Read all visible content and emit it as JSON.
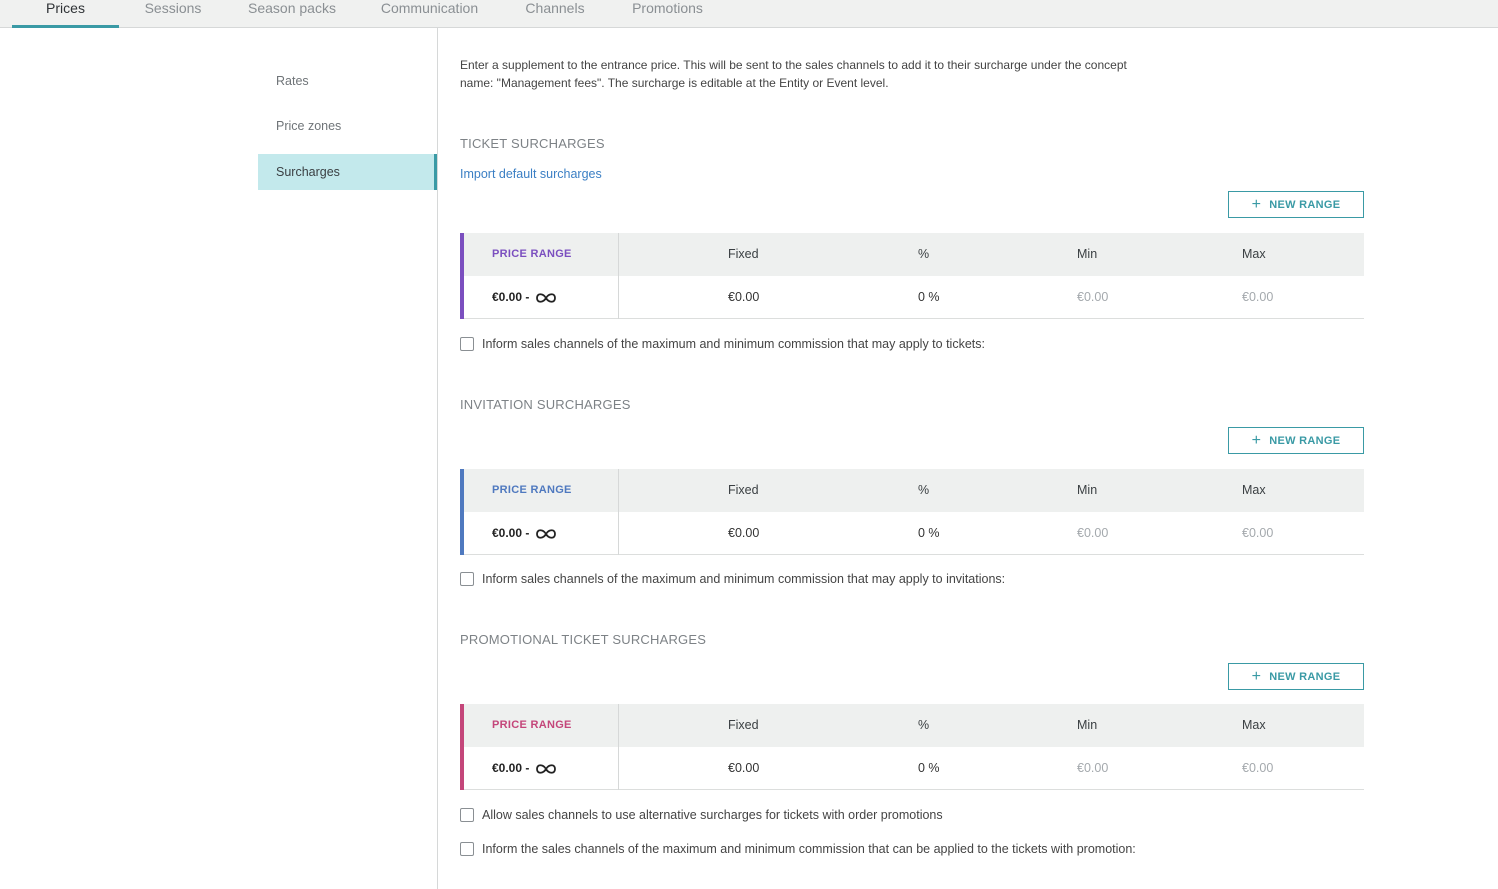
{
  "tabs": [
    {
      "label": "Prices"
    },
    {
      "label": "Sessions"
    },
    {
      "label": "Season packs"
    },
    {
      "label": "Communication"
    },
    {
      "label": "Channels"
    },
    {
      "label": "Promotions"
    }
  ],
  "active_tab": "Prices",
  "sidebar": {
    "items": [
      {
        "label": "Rates"
      },
      {
        "label": "Price zones"
      },
      {
        "label": "Surcharges"
      }
    ],
    "active_item": "Surcharges"
  },
  "intro": "Enter a supplement to the entrance price. This will be sent to the sales channels to add it to their surcharge under the concept name: \"Management fees\". The surcharge is editable at the Entity or Event level.",
  "columns": {
    "price_range": "PRICE RANGE",
    "fixed": "Fixed",
    "percent": "%",
    "min": "Min",
    "max": "Max"
  },
  "new_range_label": "NEW RANGE",
  "sections": {
    "ticket": {
      "title": "TICKET SURCHARGES",
      "import_link": "Import default surcharges",
      "accent_color": "#7b4fbf",
      "row": {
        "range": "€0.00 -",
        "fixed": "€0.00",
        "percent": "0 %",
        "min": "€0.00",
        "max": "€0.00"
      },
      "checkboxes": [
        {
          "label": "Inform sales channels of the maximum and minimum commission that may apply to tickets:",
          "checked": false
        }
      ]
    },
    "invitation": {
      "title": "INVITATION SURCHARGES",
      "accent_color": "#4f79bf",
      "row": {
        "range": "€0.00 -",
        "fixed": "€0.00",
        "percent": "0 %",
        "min": "€0.00",
        "max": "€0.00"
      },
      "checkboxes": [
        {
          "label": "Inform sales channels of the maximum and minimum commission that may apply to invitations:",
          "checked": false
        }
      ]
    },
    "promotional": {
      "title": "PROMOTIONAL TICKET SURCHARGES",
      "accent_color": "#c4467a",
      "row": {
        "range": "€0.00 -",
        "fixed": "€0.00",
        "percent": "0 %",
        "min": "€0.00",
        "max": "€0.00"
      },
      "checkboxes": [
        {
          "label": "Allow sales channels to use alternative surcharges for tickets with order promotions",
          "checked": false
        },
        {
          "label": "Inform the sales channels of the maximum and minimum commission that can be applied to the tickets with promotion:",
          "checked": false
        }
      ]
    }
  },
  "icons": {
    "infinity": "infinity-icon",
    "plus": "plus-icon",
    "checkbox": "checkbox-icon"
  }
}
